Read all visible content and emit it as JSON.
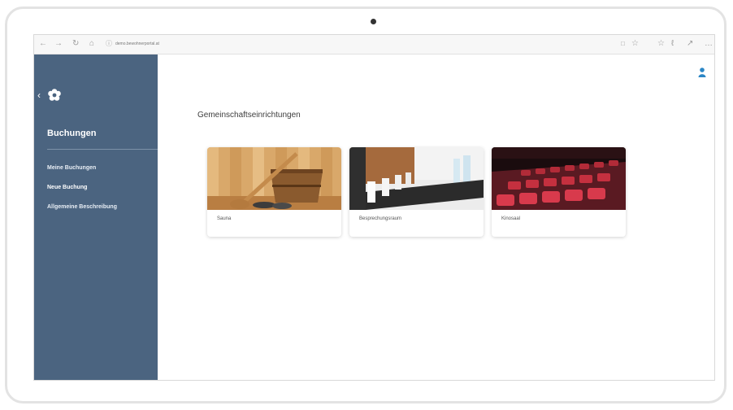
{
  "browser": {
    "url": "demo.bewohnerportal.at"
  },
  "sidebar": {
    "title": "Buchungen",
    "items": [
      {
        "label": "Meine Buchungen"
      },
      {
        "label": "Neue Buchung"
      },
      {
        "label": "Allgemeine Beschreibung"
      }
    ]
  },
  "main": {
    "heading": "Gemeinschaftseinrichtungen",
    "cards": [
      {
        "label": "Sauna"
      },
      {
        "label": "Besprechungsraum"
      },
      {
        "label": "Kinosaal"
      }
    ]
  },
  "colors": {
    "sidebar": "#4b6480",
    "user_icon": "#2b86c5"
  }
}
